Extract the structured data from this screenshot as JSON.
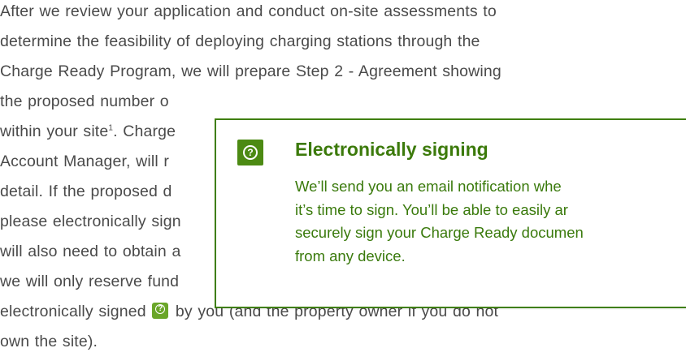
{
  "paragraph": {
    "lines": [
      "After we review your application and conduct on-site assessments to",
      "determine the feasibility of deploying charging stations through the",
      "Charge Ready Program, we will prepare Step 2 - Agreement showing",
      "the proposed number o",
      "within your site",
      "Account Manager, will r",
      "detail. If the proposed d",
      "please electronically sign",
      "will also need to obtain a",
      "we will only reserve fund",
      "own the site)."
    ],
    "site_footnote": "1",
    "site_suffix": ". Charge",
    "signed_prefix": "electronically signed",
    "signed_suffix": "by you (and the property owner if you do not"
  },
  "tooltip": {
    "icon": "question-circle-icon",
    "title": "Electronically signing",
    "body_lines": [
      "We’ll send you an email notification whe",
      "it’s time to sign. You’ll be able to easily ar",
      "securely sign your Charge Ready documen",
      "from any device."
    ]
  },
  "colors": {
    "body_text": "#4a4a4a",
    "accent_green": "#3c7a0b",
    "icon_green": "#6aa629"
  }
}
